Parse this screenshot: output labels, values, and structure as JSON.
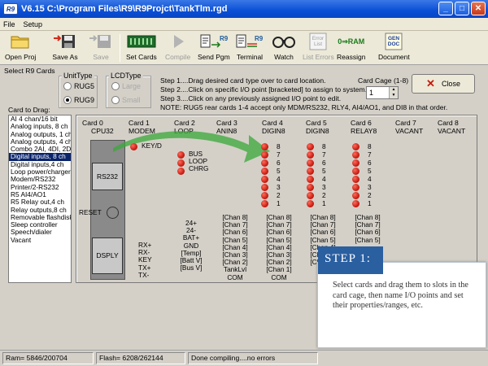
{
  "window": {
    "app_icon": "R9",
    "title": "V6.15  C:\\Program Files\\R9\\R9Projct\\TankTlm.rgd",
    "minimize": "_",
    "maximize": "□",
    "close": "✕"
  },
  "menu": [
    "File",
    "Setup"
  ],
  "toolbar": {
    "open_proj": "Open Proj",
    "save_as": "Save As",
    "save": "Save",
    "set_cards": "Set Cards",
    "compile": "Compile",
    "send_pgm": "Send Pgm",
    "terminal": "Terminal",
    "watch": "Watch",
    "list_errors": "List Errors",
    "reassign": "Reassign",
    "document": "Document",
    "icon_text_send": "R9",
    "icon_text_terminal": "R9",
    "icon_text_errors_1": "Error",
    "icon_text_errors_2": "List",
    "icon_text_reassign": "0⇒RAM",
    "icon_text_doc_1": "GEN",
    "icon_text_doc_2": "DOC"
  },
  "select_group_label": "Select R9 Cards",
  "unit_type": {
    "label": "UnitType",
    "options": [
      "RUG5",
      "RUG9"
    ],
    "selected": "RUG9"
  },
  "lcd_type": {
    "label": "LCDType",
    "options": [
      "Large",
      "Small"
    ]
  },
  "steps": [
    "Step 1....Drag desired card type over to card location.",
    "Step 2....Click on specific I/O point [bracketed] to assign to system.",
    "Step 3....Click on any previously assigned I/O point to edit.",
    "NOTE: RUG5 rear cards 1-4 accept only MDM/RS232, RLY4, AI4/AO1, and DI8 in that order."
  ],
  "card_cage": {
    "label": "Card Cage (1-8)",
    "value": "1"
  },
  "close_button": "Close",
  "card_to_drag_label": "Card to Drag:",
  "card_list": [
    "AI 4 chan/16 bit",
    "Analog inputs, 8 ch",
    "Analog outputs, 1 ch",
    "Analog outputs, 4 ch",
    "Combo 2AI, 4DI, 2DO",
    "Digital inputs, 8 ch",
    "Digital inputs,4 ch",
    "Loop power/charger",
    "Modem/RS232",
    "Printer/2-RS232",
    "R5 AI4/AO1",
    "R5 Relay out,4 ch",
    "Relay outputs,8 ch",
    "Removable flashdisk",
    "Sleep controller",
    "Speech/dialer",
    "Vacant"
  ],
  "selected_card": "Digital inputs, 8 ch",
  "cards": [
    {
      "slot": "Card 0",
      "type": "CPU32"
    },
    {
      "slot": "Card 1",
      "type": "MODEM"
    },
    {
      "slot": "Card 2",
      "type": "LOOP"
    },
    {
      "slot": "Card 3",
      "type": "ANIN8"
    },
    {
      "slot": "Card 4",
      "type": "DIGIN8"
    },
    {
      "slot": "Card 5",
      "type": "DIGIN8"
    },
    {
      "slot": "Card 6",
      "type": "RELAY8"
    },
    {
      "slot": "Card 7",
      "type": "VACANT"
    },
    {
      "slot": "Card 8",
      "type": "VACANT"
    }
  ],
  "cpu": {
    "port": "RS232",
    "reset": "RESET",
    "display": "DSPLY"
  },
  "modem": {
    "led": "KEY/D",
    "pins": [
      "RX+",
      "RX-",
      "KEY",
      "TX+",
      "TX-"
    ]
  },
  "loop": {
    "leds": [
      "BUS",
      "LOOP",
      "CHRG"
    ],
    "pins": [
      "24+",
      "24-",
      "BAT+",
      "GND",
      "[Temp]",
      "[Batt V]",
      "[Bus V]"
    ]
  },
  "anin8": {
    "chans": [
      "[Chan 8]",
      "[Chan 7]",
      "[Chan 6]",
      "[Chan 5]",
      "[Chan 4]",
      "[Chan 3]",
      "[Chan 2]",
      "TankLvl",
      "COM"
    ]
  },
  "digin4": {
    "nums": [
      "8",
      "7",
      "6",
      "5",
      "4",
      "3",
      "2",
      "1"
    ],
    "chans": [
      "[Chan 8]",
      "[Chan 7]",
      "[Chan 6]",
      "[Chan 5]",
      "[Chan 4]",
      "[Chan 3]",
      "[Chan 2]",
      "[Chan 1]",
      "COM"
    ]
  },
  "digin5": {
    "nums": [
      "8",
      "7",
      "6",
      "5",
      "4",
      "3",
      "2",
      "1"
    ],
    "chans": [
      "[Chan 8]",
      "[Chan 7]",
      "[Chan 6]",
      "[Chan 5]",
      "[Chan 4]",
      "[Chan 3]",
      "[Chan 2]"
    ]
  },
  "relay8": {
    "nums": [
      "8",
      "7",
      "6",
      "5",
      "4",
      "3",
      "2",
      "1"
    ],
    "chans": [
      "[Chan 8]",
      "[Chan 7]",
      "[Chan 6]",
      "[Chan 5]"
    ]
  },
  "status": {
    "ram": "Ram= 5846/200704",
    "flash": "Flash= 6208/262144",
    "message": "Done compiling....no errors"
  },
  "callout": {
    "title": "STEP 1:",
    "text": "Select cards and drag them to slots in the card cage, then name I/O points and set their properties/ranges, etc."
  },
  "colors": {
    "titlebar": "#0a4fd6",
    "led": "#c0140a",
    "arrow": "#3aa83a",
    "callout_title": "#2a5fa0",
    "selection": "#0a246a"
  }
}
